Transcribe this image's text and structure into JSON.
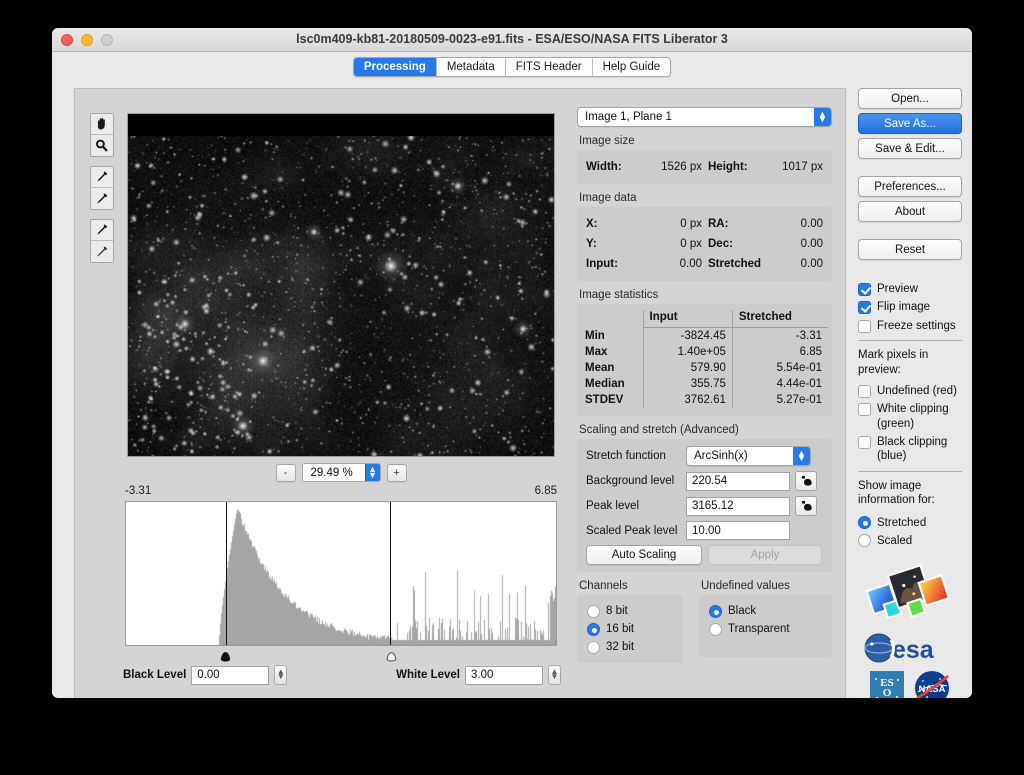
{
  "window": {
    "title": "lsc0m409-kb81-20180509-0023-e91.fits - ESA/ESO/NASA FITS Liberator 3"
  },
  "tabs": [
    {
      "label": "Processing",
      "active": true
    },
    {
      "label": "Metadata",
      "active": false
    },
    {
      "label": "FITS Header",
      "active": false
    },
    {
      "label": "Help Guide",
      "active": false
    }
  ],
  "tools": [
    {
      "name": "hand-tool",
      "glyph": "hand"
    },
    {
      "name": "zoom-tool",
      "glyph": "magnifier"
    },
    {
      "name": "background-picker-tool",
      "glyph": "eyedropper"
    },
    {
      "name": "peak-picker-tool",
      "glyph": "eyedropper"
    },
    {
      "name": "black-level-picker-tool",
      "glyph": "eyedropper"
    },
    {
      "name": "white-level-picker-tool",
      "glyph": "eyedropper"
    }
  ],
  "zoom": {
    "decrease_label": "-",
    "increase_label": "+",
    "value": "29.49 %"
  },
  "histogram": {
    "min_label": "-3.31",
    "max_label": "6.85",
    "black_marker_pct": 23.2,
    "white_marker_pct": 61.5,
    "black_handle_pct": 23.2,
    "white_handle_pct": 61.5
  },
  "levels": {
    "black_label": "Black Level",
    "black_value": "0.00",
    "white_label": "White Level",
    "white_value": "3.00"
  },
  "image_selector": {
    "value": "Image 1, Plane 1"
  },
  "image_size": {
    "title": "Image size",
    "width_label": "Width:",
    "width_value": "1526 px",
    "height_label": "Height:",
    "height_value": "1017 px"
  },
  "image_data": {
    "title": "Image data",
    "rows": [
      {
        "k1": "X:",
        "v1": "0 px",
        "k2": "RA:",
        "v2": "0.00"
      },
      {
        "k1": "Y:",
        "v1": "0 px",
        "k2": "Dec:",
        "v2": "0.00"
      },
      {
        "k1": "Input:",
        "v1": "0.00",
        "k2": "Stretched",
        "v2": "0.00"
      }
    ]
  },
  "image_statistics": {
    "title": "Image statistics",
    "col_input": "Input",
    "col_stretched": "Stretched",
    "rows": [
      {
        "name": "Min",
        "input": "-3824.45",
        "stretched": "-3.31"
      },
      {
        "name": "Max",
        "input": "1.40e+05",
        "stretched": "6.85"
      },
      {
        "name": "Mean",
        "input": "579.90",
        "stretched": "5.54e-01"
      },
      {
        "name": "Median",
        "input": "355.75",
        "stretched": "4.44e-01"
      },
      {
        "name": "STDEV",
        "input": "3762.61",
        "stretched": "5.27e-01"
      }
    ]
  },
  "scaling": {
    "title": "Scaling and stretch (Advanced)",
    "stretch_label": "Stretch function",
    "stretch_value": "ArcSinh(x)",
    "background_label": "Background level",
    "background_value": "220.54",
    "peak_label": "Peak level",
    "peak_value": "3165.12",
    "scaled_peak_label": "Scaled Peak level",
    "scaled_peak_value": "10.00",
    "auto_scaling_label": "Auto Scaling",
    "apply_label": "Apply"
  },
  "channels": {
    "title": "Channels",
    "options": [
      {
        "label": "8 bit",
        "selected": false
      },
      {
        "label": "16 bit",
        "selected": true
      },
      {
        "label": "32 bit",
        "selected": false
      }
    ]
  },
  "undefined_values": {
    "title": "Undefined values",
    "options": [
      {
        "label": "Black",
        "selected": true
      },
      {
        "label": "Transparent",
        "selected": false
      }
    ]
  },
  "sidebar": {
    "buttons": [
      {
        "label": "Open...",
        "primary": false
      },
      {
        "label": "Save As...",
        "primary": true
      },
      {
        "label": "Save & Edit...",
        "primary": false
      },
      {
        "label": "Preferences...",
        "primary": false
      },
      {
        "label": "About",
        "primary": false
      },
      {
        "label": "Reset",
        "primary": false
      }
    ],
    "checkboxes": [
      {
        "label": "Preview",
        "checked": true
      },
      {
        "label": "Flip image",
        "checked": true
      },
      {
        "label": "Freeze settings",
        "checked": false
      }
    ],
    "mark_pixels_title": "Mark pixels in preview:",
    "mark_pixels": [
      {
        "label": "Undefined (red)",
        "checked": false
      },
      {
        "label": "White clipping (green)",
        "checked": false
      },
      {
        "label": "Black clipping (blue)",
        "checked": false
      }
    ],
    "show_info_title": "Show image information for:",
    "show_info_options": [
      {
        "label": "Stretched",
        "selected": true
      },
      {
        "label": "Scaled",
        "selected": false
      }
    ],
    "logos": [
      "fits-liberator-logo",
      "esa-logo",
      "eso-logo",
      "nasa-logo"
    ]
  },
  "colors": {
    "accent": "#2479ec",
    "window_bg": "#e8e8e8",
    "panel_bg": "#d4d4d4",
    "group_bg": "#cccccc"
  }
}
